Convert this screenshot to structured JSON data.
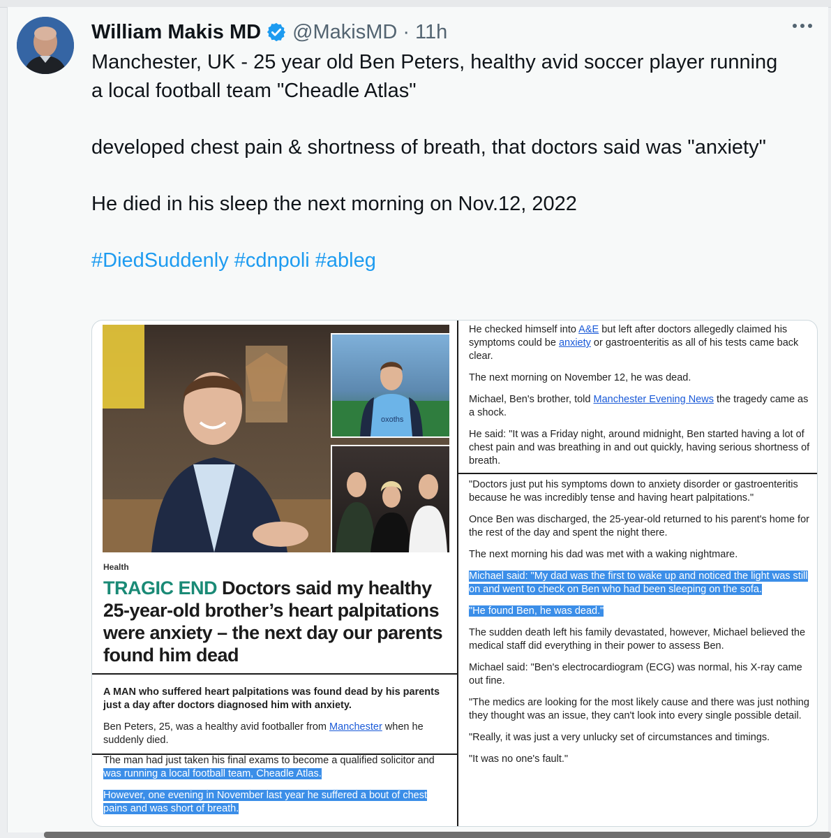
{
  "tweet": {
    "author_name": "William Makis MD",
    "handle": "@MakisMD",
    "separator": "·",
    "time": "11h",
    "paragraphs": [
      "Manchester, UK - 25 year old Ben Peters, healthy avid soccer player running a local football team \"Cheadle Atlas\"",
      "developed chest pain & shortness of breath, that doctors said was \"anxiety\"",
      "He died in his sleep the next morning on Nov.12, 2022"
    ],
    "hashtags": [
      "#DiedSuddenly",
      "#cdnpoli",
      "#ableg"
    ]
  },
  "article": {
    "section": "Health",
    "kicker": "TRAGIC END",
    "headline": "Doctors said my healthy 25-year-old brother’s heart palpitations were anxiety – the next day our parents found him dead",
    "lede": "A MAN who suffered heart palpitations was found dead by his parents just a day after doctors diagnosed him with anxiety.",
    "p1_a": "Ben Peters, 25, was a healthy avid footballer from ",
    "p1_link": "Manchester",
    "p1_b": " when he suddenly died.",
    "p2_a": "The man had just taken his final exams to become a qualified solicitor and ",
    "p2_hl": "was running a local football team, Cheadle Atlas.",
    "p3_hl": "However, one evening in November last year he suffered a bout of chest pains and was short of breath.",
    "r1_a": "He checked himself into ",
    "r1_link1": "A&E",
    "r1_b": " but left after doctors allegedly claimed his symptoms could be ",
    "r1_link2": "anxiety",
    "r1_c": " or gastroenteritis as all of his tests came back clear.",
    "r2": "The next morning on November 12, he was dead.",
    "r3_a": "Michael, Ben's brother, told ",
    "r3_link": "Manchester Evening News",
    "r3_b": " the tragedy came as a shock.",
    "r4": "He said: \"It was a Friday night, around midnight, Ben started having a lot of chest pain and was breathing in and out quickly, having serious shortness of breath.",
    "r5": "\"Doctors just put his symptoms down to anxiety disorder or gastroenteritis because he was incredibly tense and having heart palpitations.\"",
    "r6": "Once Ben was discharged, the 25-year-old returned to his parent's home for the rest of the day and spent the night there.",
    "r7": "The next morning his dad was met with a waking nightmare.",
    "r8_hl": "Michael said: \"My dad was the first to wake up and noticed the light was still on and went to check on Ben who had been sleeping on the sofa.",
    "r9_hl": "\"He found Ben, he was dead.\"",
    "r10": "The sudden death left his family devastated, however, Michael believed the medical staff did everything in their power to assess Ben.",
    "r11": "Michael said: \"Ben's electrocardiogram (ECG) was normal, his X-ray came out fine.",
    "r12": "\"The medics are looking for the most likely cause and there was just nothing they thought was an issue, they can't look into every single possible detail.",
    "r13": "\"Really, it was just a very unlucky set of circumstances and timings.",
    "r14": "\"It was no one's fault.\"",
    "shirt_text": "oxoths"
  },
  "colors": {
    "link": "#1d9bf0",
    "verified": "#1d9bf0",
    "kicker": "#1a8a76",
    "highlight": "#3b8ee8"
  },
  "icons": [
    "verified-badge-icon",
    "more-options-icon"
  ]
}
